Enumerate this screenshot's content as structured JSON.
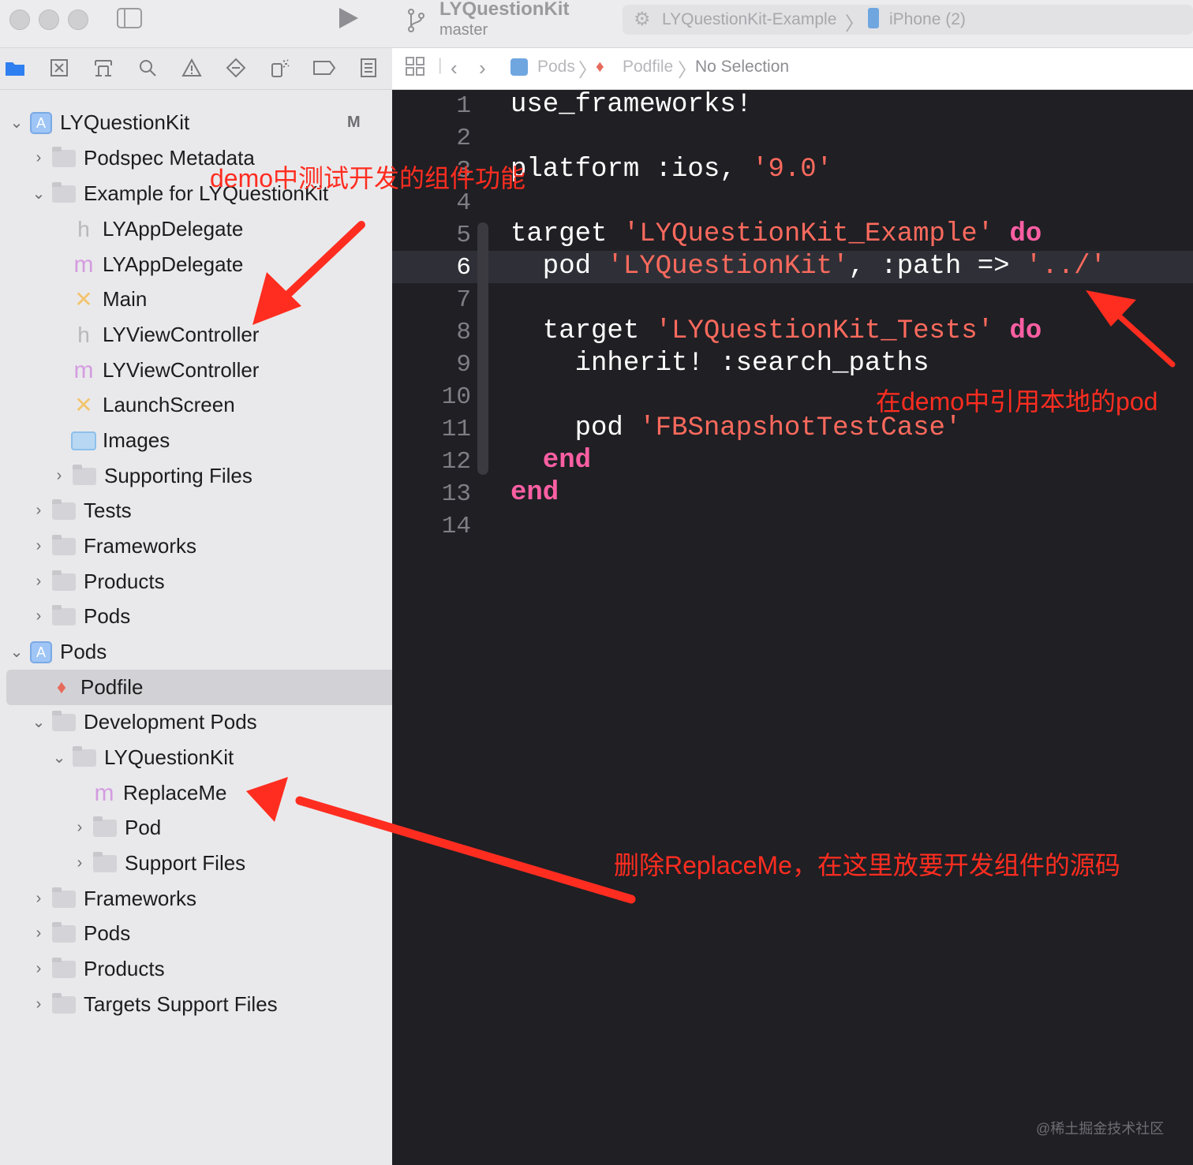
{
  "window": {
    "project_name": "LYQuestionKit",
    "branch": "master",
    "scheme": "LYQuestionKit-Example",
    "device": "iPhone (2)"
  },
  "jumpbar": {
    "crumbs": [
      "Pods",
      "Podfile",
      "No Selection"
    ]
  },
  "navigator": {
    "items": [
      {
        "label": "LYQuestionKit",
        "kind": "project",
        "badge": "M"
      },
      {
        "label": "Podspec Metadata",
        "kind": "folder"
      },
      {
        "label": "Example for LYQuestionKit",
        "kind": "folder"
      },
      {
        "label": "LYAppDelegate",
        "kind": "h"
      },
      {
        "label": "LYAppDelegate",
        "kind": "m"
      },
      {
        "label": "Main",
        "kind": "storyboard"
      },
      {
        "label": "LYViewController",
        "kind": "h"
      },
      {
        "label": "LYViewController",
        "kind": "m"
      },
      {
        "label": "LaunchScreen",
        "kind": "storyboard"
      },
      {
        "label": "Images",
        "kind": "assets"
      },
      {
        "label": "Supporting Files",
        "kind": "folder"
      },
      {
        "label": "Tests",
        "kind": "folder"
      },
      {
        "label": "Frameworks",
        "kind": "folder"
      },
      {
        "label": "Products",
        "kind": "folder"
      },
      {
        "label": "Pods",
        "kind": "folder"
      },
      {
        "label": "Pods",
        "kind": "project"
      },
      {
        "label": "Podfile",
        "kind": "ruby",
        "selected": true
      },
      {
        "label": "Development Pods",
        "kind": "folder"
      },
      {
        "label": "LYQuestionKit",
        "kind": "folder"
      },
      {
        "label": "ReplaceMe",
        "kind": "m"
      },
      {
        "label": "Pod",
        "kind": "folder"
      },
      {
        "label": "Support Files",
        "kind": "folder"
      },
      {
        "label": "Frameworks",
        "kind": "folder"
      },
      {
        "label": "Pods",
        "kind": "folder"
      },
      {
        "label": "Products",
        "kind": "folder"
      },
      {
        "label": "Targets Support Files",
        "kind": "folder"
      }
    ]
  },
  "editor": {
    "current_line": 6,
    "line_numbers": [
      "1",
      "2",
      "3",
      "4",
      "5",
      "6",
      "7",
      "8",
      "9",
      "10",
      "11",
      "12",
      "13",
      "14"
    ],
    "code": {
      "l1": "use_frameworks!",
      "l3a": "platform :ios, ",
      "l3b": "'9.0'",
      "l5a": "target ",
      "l5b": "'LYQuestionKit_Example'",
      "l5c": " do",
      "l6a": "  pod ",
      "l6b": "'LYQuestionKit'",
      "l6c": ", :path => ",
      "l6d": "'../'",
      "l8a": "  target ",
      "l8b": "'LYQuestionKit_Tests'",
      "l8c": " do",
      "l9": "    inherit! :search_paths",
      "l11a": "    pod ",
      "l11b": "'FBSnapshotTestCase'",
      "l12": "  end",
      "l13": "end"
    }
  },
  "annotations": {
    "demo_test": "demo中测试开发的组件功能",
    "local_pod": "在demo中引用本地的pod",
    "replace_me": "删除ReplaceMe，在这里放要开发组件的源码"
  },
  "watermark": "@稀土掘金技术社区",
  "colors": {
    "annotation": "#ff2d20",
    "keyword": "#fc5fa3",
    "string": "#fc6a5d",
    "editor_bg": "#1f1f24"
  }
}
